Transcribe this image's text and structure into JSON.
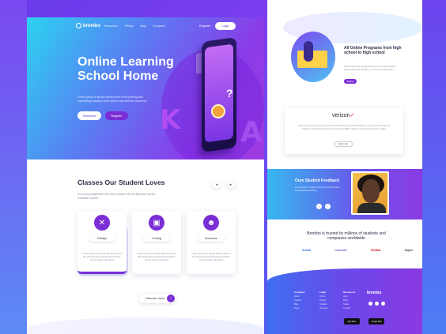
{
  "brand": {
    "name": "brembo"
  },
  "nav": {
    "links": [
      "Resources",
      "Pricing",
      "Blog",
      "Company"
    ],
    "register": "Register",
    "login": "Login"
  },
  "hero": {
    "title": "Online Learning School Home",
    "subtitle": "Lorem ipsum is simply dummy text of the printing and typesetting industry.Lorem ipsum has been the industry's",
    "subscribe": "Subscribe",
    "register": "Register"
  },
  "classes": {
    "title": "Classes Our Student Loves",
    "subtitle": "It's a long established fact that a reader will be distracted by the readable content.",
    "items": [
      {
        "label": "Design",
        "icon": "close-icon",
        "desc": "Lorem ipsum is simply dummy text of the printing and typesetting industry. Lorem ipsum has been"
      },
      {
        "label": "Coding",
        "icon": "image-icon",
        "desc": "Lorem ipsum is simply dummy text of the printing and typesetting industry. Lorem ipsum has been"
      },
      {
        "label": "Business",
        "icon": "person-icon",
        "desc": "Lorem ipsum is simply dummy text of the printing and typesetting industry. Lorem ipsum has been"
      }
    ],
    "discover": "Discover more"
  },
  "programs": {
    "title": "All Online Programs from high school to high school",
    "subtitle": "Lorem ipsum is simply dummy text of the printing and typesetting industry. Lorem ipsum has been",
    "button": "Explore"
  },
  "testimonial": {
    "company": "verizon",
    "text": "Lorem ipsum is simply dummy text of the printing and typesetting industry. Lorem ipsum has been the industry's standard dummy text ever since the 1500s, when an unknown printer took a galley",
    "button": "Read more"
  },
  "feedback": {
    "title": "Oure Student Feedback",
    "text": "Lorem ipsum is simply dummy text of the printing and typesetting industry."
  },
  "trusted": {
    "text": "Brembo is trusted by millions of students and companies worldwide",
    "brands": [
      "Airbnb",
      "Lavender",
      "RedHat",
      "Zapier"
    ]
  },
  "footer": {
    "columns": [
      {
        "title": "Company",
        "items": [
          "About",
          "Careers",
          "Blog",
          "Press"
        ]
      },
      {
        "title": "Legal",
        "items": [
          "Terms",
          "Privacy",
          "Cookies",
          "Licenses"
        ]
      },
      {
        "title": "Resources",
        "items": [
          "Help",
          "Docs",
          "Status",
          "Contact"
        ]
      }
    ],
    "app_store": "App Store",
    "google_play": "Google Play"
  },
  "colors": {
    "primary": "#7b2ed6",
    "accent": "#2bd3f0"
  }
}
